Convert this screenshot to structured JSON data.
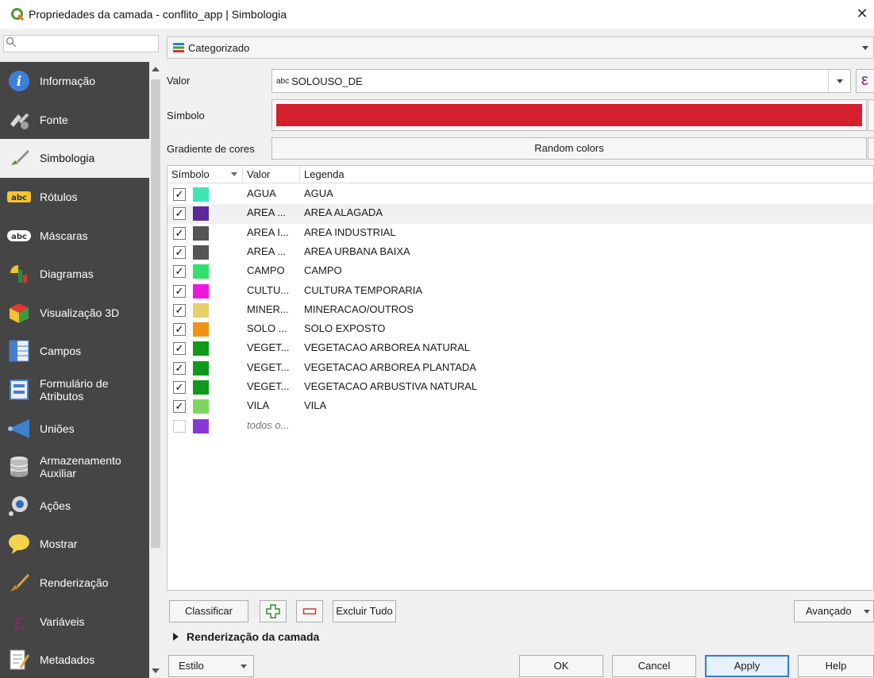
{
  "window": {
    "title": "Propriedades da camada - conflito_app | Simbologia"
  },
  "search": {
    "placeholder": ""
  },
  "sidebar": {
    "items": [
      {
        "label": "Informação",
        "icon": "info-icon"
      },
      {
        "label": "Fonte",
        "icon": "source-icon"
      },
      {
        "label": "Simbologia",
        "icon": "symbology-brush-icon",
        "active": true
      },
      {
        "label": "Rótulos",
        "icon": "labels-abc-icon"
      },
      {
        "label": "Máscaras",
        "icon": "masks-abc-icon"
      },
      {
        "label": "Diagramas",
        "icon": "diagrams-icon"
      },
      {
        "label": "Visualização 3D",
        "icon": "3d-cube-icon"
      },
      {
        "label": "Campos",
        "icon": "fields-table-icon"
      },
      {
        "label": "Formulário de\nAtributos",
        "icon": "form-icon"
      },
      {
        "label": "Uniões",
        "icon": "joins-icon"
      },
      {
        "label": "Armazenamento\nAuxiliar",
        "icon": "database-icon"
      },
      {
        "label": "Ações",
        "icon": "actions-gear-icon"
      },
      {
        "label": "Mostrar",
        "icon": "display-speech-icon"
      },
      {
        "label": "Renderização",
        "icon": "rendering-brush-icon"
      },
      {
        "label": "Variáveis",
        "icon": "epsilon-icon"
      },
      {
        "label": "Metadados",
        "icon": "metadata-icon"
      }
    ]
  },
  "renderer": {
    "selected": "Categorizado"
  },
  "form": {
    "value_label": "Valor",
    "value_prefix": "abc",
    "value": "SOLOUSO_DE",
    "expr_symbol": "ε",
    "symbol_label": "Símbolo",
    "symbol_color": "#d41f2c",
    "gradient_label": "Gradiente de cores",
    "gradient_value": "Random colors"
  },
  "table": {
    "headers": {
      "symbol": "Símbolo",
      "value": "Valor",
      "legend": "Legenda"
    },
    "rows": [
      {
        "checked": true,
        "color": "#3fe6b4",
        "value": "AGUA",
        "legend": "AGUA"
      },
      {
        "checked": true,
        "color": "#5a2a9a",
        "value": "AREA ...",
        "legend": "AREA ALAGADA"
      },
      {
        "checked": true,
        "color": "#555555",
        "value": "AREA I...",
        "legend": "AREA INDUSTRIAL"
      },
      {
        "checked": true,
        "color": "#555555",
        "value": "AREA ...",
        "legend": "AREA URBANA BAIXA"
      },
      {
        "checked": true,
        "color": "#33e06a",
        "value": "CAMPO",
        "legend": "CAMPO"
      },
      {
        "checked": true,
        "color": "#ef16e2",
        "value": "CULTU...",
        "legend": "CULTURA TEMPORARIA"
      },
      {
        "checked": true,
        "color": "#e6cf6a",
        "value": "MINER...",
        "legend": "MINERACAO/OUTROS"
      },
      {
        "checked": true,
        "color": "#ef9412",
        "value": "SOLO ...",
        "legend": "SOLO EXPOSTO"
      },
      {
        "checked": true,
        "color": "#0f9a1a",
        "value": "VEGET...",
        "legend": "VEGETACAO ARBOREA NATURAL"
      },
      {
        "checked": true,
        "color": "#0f9a1a",
        "value": "VEGET...",
        "legend": "VEGETACAO ARBOREA PLANTADA"
      },
      {
        "checked": true,
        "color": "#0f9a1a",
        "value": "VEGET...",
        "legend": "VEGETACAO ARBUSTIVA NATURAL"
      },
      {
        "checked": true,
        "color": "#7cd75c",
        "value": "VILA",
        "legend": "VILA"
      },
      {
        "checked": false,
        "color": "#8a38d4",
        "value": "todos o...",
        "legend": ""
      }
    ]
  },
  "actions": {
    "classify": "Classificar",
    "delete_all": "Excluir Tudo",
    "advanced": "Avançado",
    "layer_rendering": "Renderização da camada"
  },
  "footer": {
    "style": "Estilo",
    "ok": "OK",
    "cancel": "Cancel",
    "apply": "Apply",
    "help": "Help"
  },
  "colors": {
    "sidebar_bg": "#454545",
    "accent": "#2a7de1"
  }
}
